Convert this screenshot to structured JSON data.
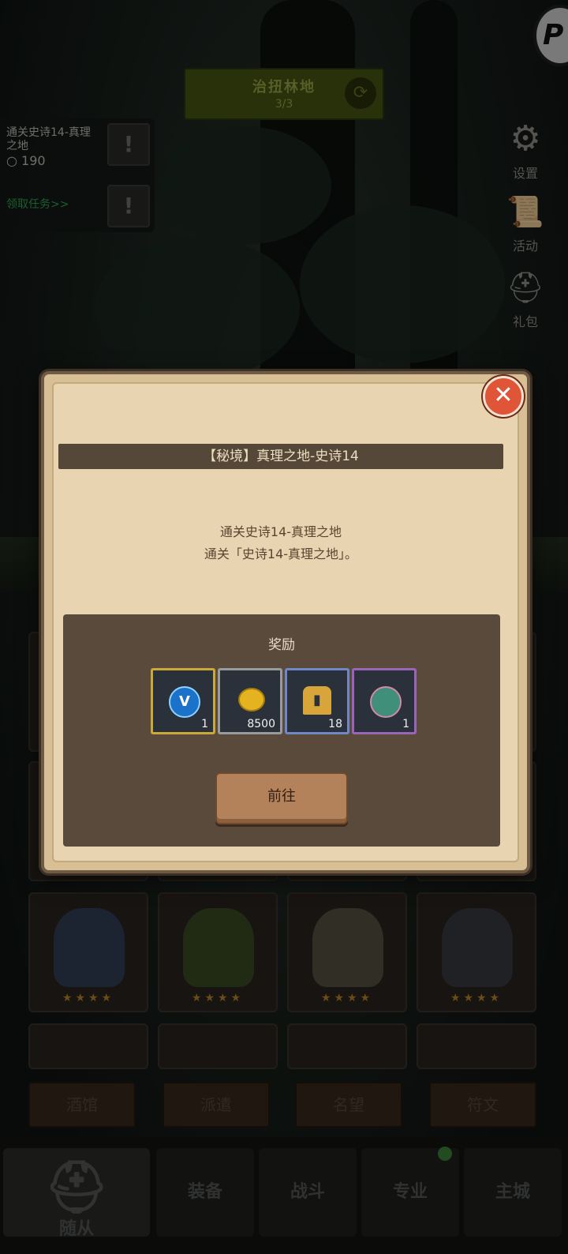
{
  "zone": {
    "name": "治扭林地",
    "progress": "3/3"
  },
  "quests": [
    {
      "title": "通关史诗14-真理之地",
      "count": "190"
    },
    {
      "link": "领取任务>>"
    }
  ],
  "side_buttons": [
    {
      "label": "设置",
      "icon": "gear-icon"
    },
    {
      "label": "活动",
      "icon": "scroll-icon"
    },
    {
      "label": "礼包",
      "icon": "gift-icon"
    }
  ],
  "roster": {
    "stars": "★★★★"
  },
  "sub_tabs": [
    "酒馆",
    "派遣",
    "名望",
    "符文"
  ],
  "nav": [
    "随从",
    "装备",
    "战斗",
    "专业",
    "主城"
  ],
  "modal": {
    "title": "【秘境】真理之地-史诗14",
    "desc_line1": "通关史诗14-真理之地",
    "desc_line2": "通关「史诗14-真理之地」。",
    "rewards_title": "奖励",
    "rewards": [
      {
        "icon": "blue-orb-icon",
        "qty": "1",
        "rarity": "gold"
      },
      {
        "icon": "gold-coin-icon",
        "qty": "8500",
        "rarity": "grey"
      },
      {
        "icon": "helmet-icon",
        "qty": "18",
        "rarity": "blue"
      },
      {
        "icon": "green-egg-icon",
        "qty": "1",
        "rarity": "purple"
      }
    ],
    "go_label": "前往",
    "close_icon": "close-icon"
  },
  "colors": {
    "accent_close": "#e05537",
    "panel": "#e8d4b0",
    "title_bar": "#564839"
  }
}
